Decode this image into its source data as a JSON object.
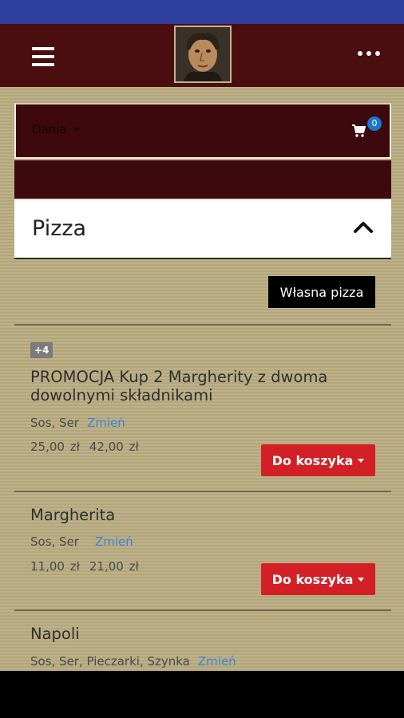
{
  "nav": {
    "dania_label": "Dania",
    "cart_count": "0"
  },
  "category": {
    "title": "Pizza"
  },
  "own_pizza_label": "Własna pizza",
  "add_to_cart_label": "Do koszyka",
  "items": [
    {
      "tag": "+4",
      "name": "PROMOCJA Kup 2 Margherity z dwoma dowolnymi składnikami",
      "ingredients": "Sos, Ser",
      "change_label": "Zmień",
      "price_small": "25,00 zł",
      "price_large": "42,00 zł"
    },
    {
      "name": "Margherita",
      "ingredients": "Sos, Ser",
      "change_label": "Zmień",
      "price_small": "11,00 zł",
      "price_large": "21,00 zł"
    },
    {
      "name": "Napoli",
      "ingredients": "Sos, Ser, Pieczarki, Szynka",
      "change_label": "Zmień"
    }
  ],
  "colors": {
    "status_bar": "#2f3f9e",
    "app_bar": "#4a0d10",
    "accent_red": "#d32027",
    "badge_blue": "#1976d2",
    "link_blue": "#3a86d6"
  }
}
